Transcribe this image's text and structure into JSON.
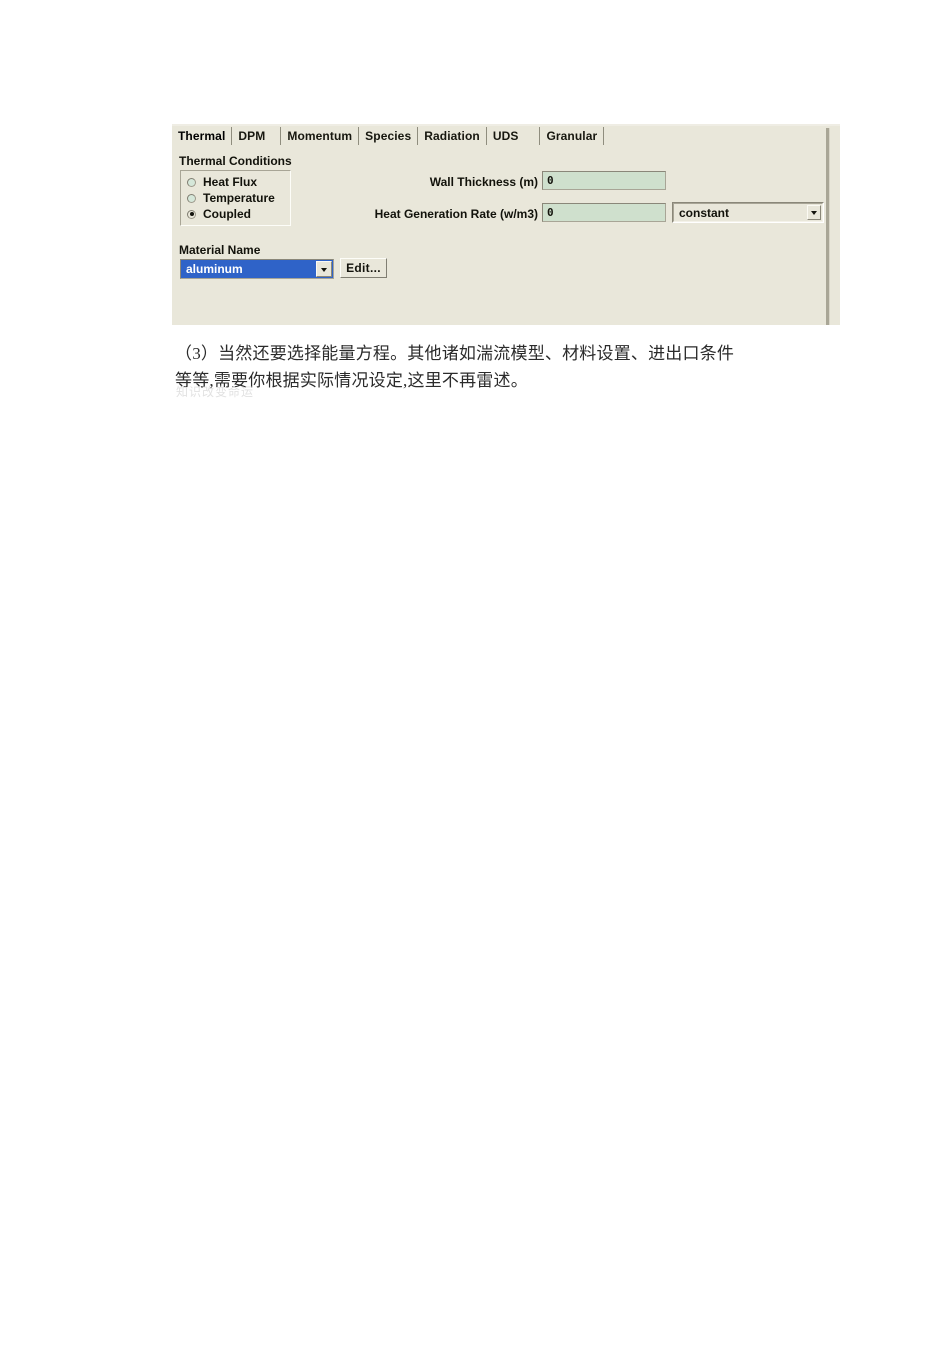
{
  "dialog": {
    "tabs": [
      {
        "label": "Thermal",
        "active": true
      },
      {
        "label": "DPM",
        "active": false
      },
      {
        "label": "Momentum",
        "active": false
      },
      {
        "label": "Species",
        "active": false
      },
      {
        "label": "Radiation",
        "active": false
      },
      {
        "label": "UDS",
        "active": false
      },
      {
        "label": "Granular",
        "active": false
      }
    ],
    "thermal_conditions": {
      "group_label": "Thermal Conditions",
      "options": [
        {
          "label": "Heat Flux",
          "selected": false
        },
        {
          "label": "Temperature",
          "selected": false
        },
        {
          "label": "Coupled",
          "selected": true
        }
      ]
    },
    "fields": {
      "wall_thickness": {
        "label": "Wall Thickness (m)",
        "value": "0"
      },
      "heat_generation_rate": {
        "label": "Heat Generation Rate (w/m3)",
        "value": "0",
        "method": "constant"
      }
    },
    "material": {
      "group_label": "Material Name",
      "selected": "aluminum",
      "edit_button": "Edit..."
    },
    "colors": {
      "panel_bg": "#e9e7da",
      "field_bg": "#cfe0cd",
      "selection_blue": "#2f63c8",
      "border": "#a8a596"
    }
  },
  "document": {
    "paragraph_line_1": "（3）当然还要选择能量方程。其他诸如湍流模型、材料设置、进出口条件",
    "paragraph_line_2": "等等,需要你根据实际情况设定,这里不再雷述。",
    "watermark": "知识改变命运"
  }
}
